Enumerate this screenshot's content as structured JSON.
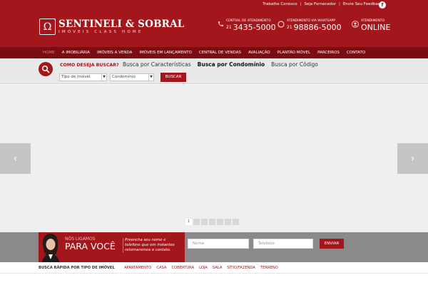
{
  "header": {
    "top_links": [
      "Trabalhe Conosco",
      "Seja Fornecedor",
      "Envie Seu Feedback"
    ],
    "facebook_icon": "facebook-icon",
    "logo": {
      "mark": "Ω",
      "name": "SENTINELI & SOBRAL",
      "tagline": "IMÓVEIS CLASS HOME"
    },
    "contacts": [
      {
        "icon": "phone-icon",
        "label": "Central de Atendimento",
        "area": "21",
        "value": "3435-5000"
      },
      {
        "icon": "whatsapp-icon",
        "label": "Atendimento via Whatsapp",
        "area": "21",
        "value": "98886-5000"
      },
      {
        "icon": "user-icon",
        "label": "Atendimento",
        "area": "",
        "value": "ONLINE"
      }
    ]
  },
  "nav": {
    "items": [
      "Home",
      "A Imobiliária",
      "Imóveis a venda",
      "Imóveis em Lançamento",
      "Central de Vendas",
      "Avaliação",
      "Plantão Móvel",
      "Parceiros",
      "Contato"
    ]
  },
  "search": {
    "question": "COMO DESEJA BUSCAR?",
    "tabs": [
      "Busca por Características",
      "Busca por Condomínio",
      "Busca por Código"
    ],
    "active_tab": "Busca por Condomínio",
    "select_type": "Tipo de Imóvel",
    "select_condo": "Condomínio",
    "button": "BUSCAR"
  },
  "slider": {
    "prev": "‹",
    "next": "›",
    "dots": [
      "1",
      "2",
      "3",
      "4",
      "5",
      "6",
      "7"
    ],
    "active_dot": 1
  },
  "callback": {
    "title_small": "NÓS LIGAMOS",
    "title_big": "PARA VOCÊ",
    "description": "Preencha seu nome e telefone que em instantes retornaremos o contato.",
    "name_placeholder": "Nome",
    "phone_placeholder": "Telefone",
    "button": "ENVIAR"
  },
  "quick": {
    "label": "BUSCA RÁPIDA POR TIPO DE IMÓVEL",
    "types": [
      "APARTAMENTO",
      "CASA",
      "COBERTURA",
      "LOJA",
      "SALA",
      "SÍTIO/FAZENDA",
      "TERRENO"
    ]
  },
  "colors": {
    "brand": "#a3161c",
    "nav": "#7b0c11",
    "slider_bg": "#efefef"
  }
}
